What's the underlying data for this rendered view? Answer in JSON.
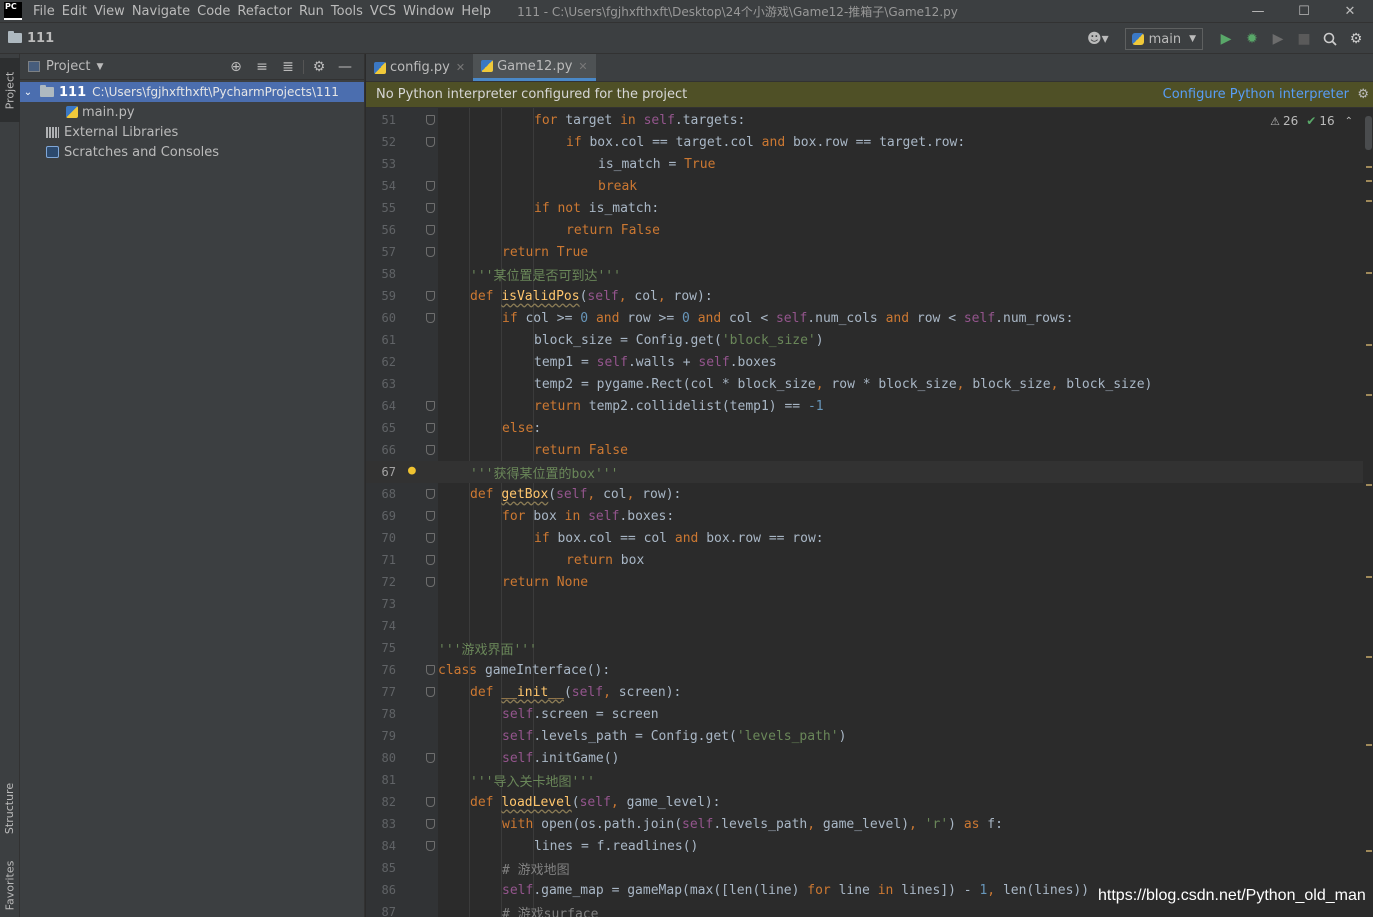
{
  "menu": {
    "logo": "PC",
    "items": [
      "File",
      "Edit",
      "View",
      "Navigate",
      "Code",
      "Refactor",
      "Run",
      "Tools",
      "VCS",
      "Window",
      "Help"
    ],
    "window_title": "111 - C:\\Users\\fgjhxfthxft\\Desktop\\24个小游戏\\Game12-推箱子\\Game12.py"
  },
  "window_controls": {
    "minimize": "—",
    "maximize": "☐",
    "close": "✕"
  },
  "navbar": {
    "project_name": "111",
    "run_config": "main"
  },
  "tool_strip": {
    "project": "Project",
    "structure": "Structure",
    "favorites": "Favorites"
  },
  "project_panel": {
    "title": "Project",
    "root_name": "111",
    "root_path": "C:\\Users\\fgjhxfthxft\\PycharmProjects\\111",
    "items": [
      "main.py",
      "External Libraries",
      "Scratches and Consoles"
    ]
  },
  "editor_tabs": [
    {
      "label": "config.py",
      "active": false
    },
    {
      "label": "Game12.py",
      "active": true
    }
  ],
  "banner": {
    "message": "No Python interpreter configured for the project",
    "link": "Configure Python interpreter"
  },
  "inspection": {
    "warnings": "26",
    "ok": "16"
  },
  "editor": {
    "current_line": 67,
    "lines": [
      {
        "n": "51",
        "indent": 3,
        "tokens": [
          [
            "kw",
            "for "
          ],
          [
            "",
            "target "
          ],
          [
            "kw",
            "in "
          ],
          [
            "slf",
            "self"
          ],
          [
            "",
            ".targets:"
          ]
        ],
        "fold": true
      },
      {
        "n": "52",
        "indent": 4,
        "tokens": [
          [
            "kw",
            "if "
          ],
          [
            "",
            "box.col == target.col "
          ],
          [
            "kw",
            "and "
          ],
          [
            "",
            "box.row == target.row:"
          ]
        ],
        "fold": true
      },
      {
        "n": "53",
        "indent": 5,
        "tokens": [
          [
            "",
            "is_match = "
          ],
          [
            "kw",
            "True"
          ]
        ]
      },
      {
        "n": "54",
        "indent": 5,
        "tokens": [
          [
            "kw",
            "break"
          ]
        ],
        "fold": true
      },
      {
        "n": "55",
        "indent": 3,
        "tokens": [
          [
            "kw",
            "if not "
          ],
          [
            "",
            "is_match:"
          ]
        ],
        "fold": true
      },
      {
        "n": "56",
        "indent": 4,
        "tokens": [
          [
            "kw",
            "return False"
          ]
        ],
        "fold": true
      },
      {
        "n": "57",
        "indent": 2,
        "tokens": [
          [
            "kw",
            "return True"
          ]
        ],
        "fold": true
      },
      {
        "n": "58",
        "indent": 1,
        "tokens": [
          [
            "str",
            "'''某位置是否可到达'''"
          ]
        ]
      },
      {
        "n": "59",
        "indent": 1,
        "tokens": [
          [
            "kw",
            "def "
          ],
          [
            "fn",
            "isValidPos"
          ],
          [
            "",
            "("
          ],
          [
            "slf",
            "self"
          ],
          [
            "kw",
            ", "
          ],
          [
            "",
            "col"
          ],
          [
            "kw",
            ", "
          ],
          [
            "",
            "row):"
          ]
        ],
        "fold": true
      },
      {
        "n": "60",
        "indent": 2,
        "tokens": [
          [
            "kw",
            "if "
          ],
          [
            "",
            "col >= "
          ],
          [
            "num",
            "0 "
          ],
          [
            "kw",
            "and "
          ],
          [
            "",
            "row >= "
          ],
          [
            "num",
            "0 "
          ],
          [
            "kw",
            "and "
          ],
          [
            "",
            "col < "
          ],
          [
            "slf",
            "self"
          ],
          [
            "",
            ".num_cols "
          ],
          [
            "kw",
            "and "
          ],
          [
            "",
            "row < "
          ],
          [
            "slf",
            "self"
          ],
          [
            "",
            ".num_rows:"
          ]
        ],
        "fold": true
      },
      {
        "n": "61",
        "indent": 3,
        "tokens": [
          [
            "",
            "block_size = Config.get("
          ],
          [
            "str",
            "'block_size'"
          ],
          [
            "",
            ")"
          ]
        ]
      },
      {
        "n": "62",
        "indent": 3,
        "tokens": [
          [
            "",
            "temp1 = "
          ],
          [
            "slf",
            "self"
          ],
          [
            "",
            ".walls + "
          ],
          [
            "slf",
            "self"
          ],
          [
            "",
            ".boxes"
          ]
        ]
      },
      {
        "n": "63",
        "indent": 3,
        "tokens": [
          [
            "",
            "temp2 = pygame.Rect(col * block_size"
          ],
          [
            "kw",
            ", "
          ],
          [
            "",
            "row * block_size"
          ],
          [
            "kw",
            ", "
          ],
          [
            "",
            "block_size"
          ],
          [
            "kw",
            ", "
          ],
          [
            "",
            "block_size)"
          ]
        ]
      },
      {
        "n": "64",
        "indent": 3,
        "tokens": [
          [
            "kw",
            "return "
          ],
          [
            "",
            "temp2.collidelist(temp1) == "
          ],
          [
            "num",
            "-1"
          ]
        ],
        "fold": true
      },
      {
        "n": "65",
        "indent": 2,
        "tokens": [
          [
            "kw",
            "else"
          ],
          [
            "",
            ":"
          ]
        ],
        "fold": true
      },
      {
        "n": "66",
        "indent": 3,
        "tokens": [
          [
            "kw",
            "return False"
          ]
        ],
        "fold": true
      },
      {
        "n": "67",
        "indent": 1,
        "tokens": [
          [
            "str",
            "'''获得某位置的box'''"
          ]
        ],
        "bulb": true
      },
      {
        "n": "68",
        "indent": 1,
        "tokens": [
          [
            "kw",
            "def "
          ],
          [
            "fn",
            "getBox"
          ],
          [
            "",
            "("
          ],
          [
            "slf",
            "self"
          ],
          [
            "kw",
            ", "
          ],
          [
            "",
            "col"
          ],
          [
            "kw",
            ", "
          ],
          [
            "",
            "row):"
          ]
        ],
        "fold": true
      },
      {
        "n": "69",
        "indent": 2,
        "tokens": [
          [
            "kw",
            "for "
          ],
          [
            "",
            "box "
          ],
          [
            "kw",
            "in "
          ],
          [
            "slf",
            "self"
          ],
          [
            "",
            ".boxes:"
          ]
        ],
        "fold": true
      },
      {
        "n": "70",
        "indent": 3,
        "tokens": [
          [
            "kw",
            "if "
          ],
          [
            "",
            "box.col == col "
          ],
          [
            "kw",
            "and "
          ],
          [
            "",
            "box.row == row:"
          ]
        ],
        "fold": true
      },
      {
        "n": "71",
        "indent": 4,
        "tokens": [
          [
            "kw",
            "return "
          ],
          [
            "",
            "box"
          ]
        ],
        "fold": true
      },
      {
        "n": "72",
        "indent": 2,
        "tokens": [
          [
            "kw",
            "return None"
          ]
        ],
        "fold": true
      },
      {
        "n": "73",
        "indent": 0,
        "tokens": []
      },
      {
        "n": "74",
        "indent": 0,
        "tokens": []
      },
      {
        "n": "75",
        "indent": 0,
        "tokens": [
          [
            "str",
            "'''游戏界面'''"
          ]
        ]
      },
      {
        "n": "76",
        "indent": 0,
        "tokens": [
          [
            "kw",
            "class "
          ],
          [
            "",
            "gameInterface():"
          ]
        ],
        "fold": true
      },
      {
        "n": "77",
        "indent": 1,
        "tokens": [
          [
            "kw",
            "def "
          ],
          [
            "fn",
            "__init__"
          ],
          [
            "",
            "("
          ],
          [
            "slf",
            "self"
          ],
          [
            "kw",
            ", "
          ],
          [
            "",
            "screen):"
          ]
        ],
        "fold": true
      },
      {
        "n": "78",
        "indent": 2,
        "tokens": [
          [
            "slf",
            "self"
          ],
          [
            "",
            ".screen = screen"
          ]
        ]
      },
      {
        "n": "79",
        "indent": 2,
        "tokens": [
          [
            "slf",
            "self"
          ],
          [
            "",
            ".levels_path = Config.get("
          ],
          [
            "str",
            "'levels_path'"
          ],
          [
            "",
            ")"
          ]
        ]
      },
      {
        "n": "80",
        "indent": 2,
        "tokens": [
          [
            "slf",
            "self"
          ],
          [
            "",
            ".initGame()"
          ]
        ],
        "fold": true
      },
      {
        "n": "81",
        "indent": 1,
        "tokens": [
          [
            "str",
            "'''导入关卡地图'''"
          ]
        ]
      },
      {
        "n": "82",
        "indent": 1,
        "tokens": [
          [
            "kw",
            "def "
          ],
          [
            "fn",
            "loadLevel"
          ],
          [
            "",
            "("
          ],
          [
            "slf",
            "self"
          ],
          [
            "kw",
            ", "
          ],
          [
            "",
            "game_level):"
          ]
        ],
        "fold": true
      },
      {
        "n": "83",
        "indent": 2,
        "tokens": [
          [
            "kw",
            "with "
          ],
          [
            "",
            "open(os.path.join("
          ],
          [
            "slf",
            "self"
          ],
          [
            "",
            ".levels_path"
          ],
          [
            "kw",
            ", "
          ],
          [
            "",
            "game_level)"
          ],
          [
            "kw",
            ", "
          ],
          [
            "str",
            "'r'"
          ],
          [
            "",
            ") "
          ],
          [
            "kw",
            "as "
          ],
          [
            "",
            "f:"
          ]
        ],
        "fold": true
      },
      {
        "n": "84",
        "indent": 3,
        "tokens": [
          [
            "",
            "lines = f.readlines()"
          ]
        ],
        "fold": true
      },
      {
        "n": "85",
        "indent": 2,
        "tokens": [
          [
            "cmt",
            "# 游戏地图"
          ]
        ]
      },
      {
        "n": "86",
        "indent": 2,
        "tokens": [
          [
            "slf",
            "self"
          ],
          [
            "",
            ".game_map = gameMap(max([len(line) "
          ],
          [
            "kw",
            "for "
          ],
          [
            "",
            "line "
          ],
          [
            "kw",
            "in "
          ],
          [
            "",
            "lines]) - "
          ],
          [
            "num",
            "1"
          ],
          [
            "kw",
            ", "
          ],
          [
            "",
            "len(lines))"
          ]
        ]
      },
      {
        "n": "87",
        "indent": 2,
        "tokens": [
          [
            "cmt",
            "# 游戏surface"
          ]
        ]
      }
    ]
  },
  "watermark": "https://blog.csdn.net/Python_old_man"
}
